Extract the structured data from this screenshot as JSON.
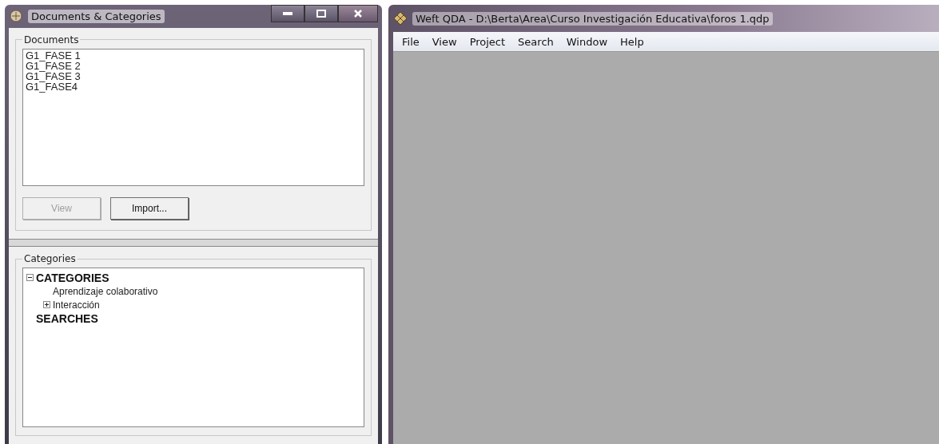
{
  "left_window": {
    "title": "Documents & Categories",
    "documents": {
      "label": "Documents",
      "items": [
        {
          "label": "G1_FASE 1"
        },
        {
          "label": "G1_FASE 2"
        },
        {
          "label": "G1_FASE 3"
        },
        {
          "label": "G1_FASE4"
        }
      ],
      "buttons": [
        {
          "label": "View",
          "disabled": true
        },
        {
          "label": "Import...",
          "disabled": false
        }
      ]
    },
    "categories": {
      "label": "Categories",
      "tree": [
        {
          "label": "CATEGORIES",
          "expanded": true,
          "children": [
            {
              "label": "Aprendizaje colaborativo"
            },
            {
              "label": "Interacción",
              "expanded": false
            }
          ]
        },
        {
          "label": "SEARCHES"
        }
      ]
    }
  },
  "main_window": {
    "title": "Weft QDA - D:\\Berta\\Area\\Curso Investigación Educativa\\foros 1.qdp",
    "menu": [
      {
        "label": "File"
      },
      {
        "label": "View"
      },
      {
        "label": "Project"
      },
      {
        "label": "Search"
      },
      {
        "label": "Window"
      },
      {
        "label": "Help"
      }
    ]
  }
}
